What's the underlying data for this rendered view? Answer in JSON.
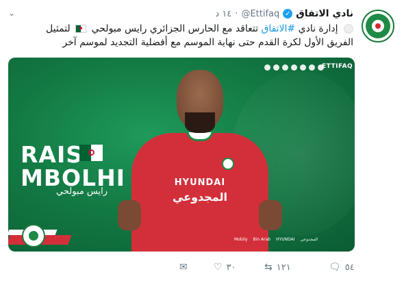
{
  "tweet": {
    "display_name": "نادي الاتفاق",
    "handle": "@Ettifaq",
    "dot": "·",
    "time": "١٤ د",
    "text_part1": "إدارة نادي",
    "hashtag": "#الاتفاق",
    "text_part2": "تتعاقد مع الحارس الجزائري رايس مبولحي",
    "text_part3": "لتمثيل الفريق الأول لكرة القدم حتى نهاية الموسم مع أفضلية التجديد لموسم آخر"
  },
  "media": {
    "handle": "ETTIFAQ",
    "first_name": "RAIS",
    "last_name": "MBOLHI",
    "arabic_name": "رايس مبولحي",
    "sponsor": "HYUNDAI",
    "sponsor_ar": "المجدوعي",
    "sponsor_logos": [
      "Mobily",
      "Bin Arab",
      "HYUNDAI",
      "المجدوعي"
    ]
  },
  "actions": {
    "reply_count": "٥٤",
    "retweet_count": "١٢١",
    "like_count": "٣٠"
  },
  "icons": {
    "caret": "chevron-down-icon",
    "verified": "verified-badge-icon",
    "reply": "reply-icon",
    "retweet": "retweet-icon",
    "like": "heart-icon",
    "message": "envelope-icon"
  },
  "colors": {
    "link": "#1b95e0",
    "verified": "#1da1f2",
    "muted": "#657786",
    "green": "#1f8a45",
    "red": "#d32f3a"
  }
}
